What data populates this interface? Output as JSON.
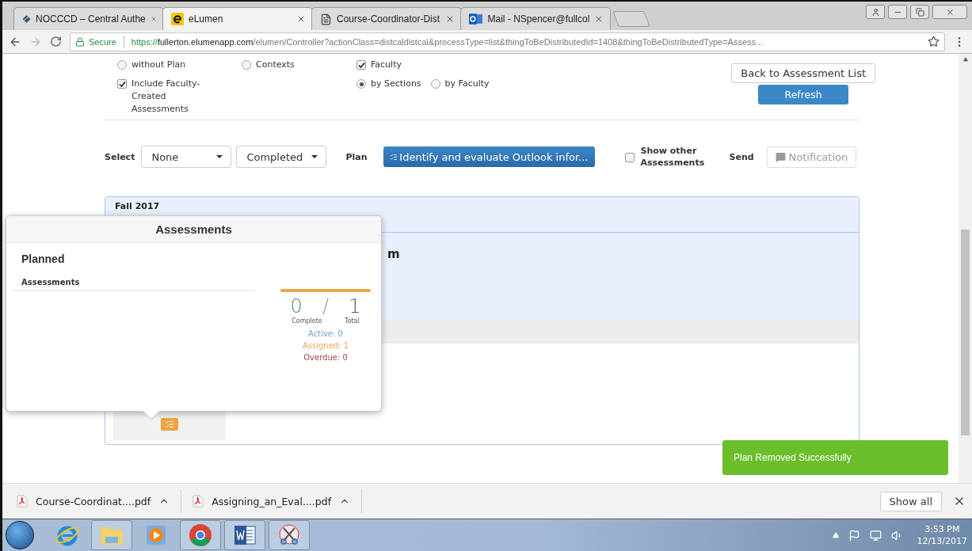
{
  "browser": {
    "tabs": [
      {
        "title": "NOCCCD – Central Authe",
        "selected": false
      },
      {
        "title": "eLumen",
        "selected": true
      },
      {
        "title": "Course-Coordinator-Dist",
        "selected": false
      },
      {
        "title": "Mail - NSpencer@fullcol",
        "selected": false
      }
    ],
    "secure_label": "Secure",
    "url_scheme": "https://",
    "url_host": "fullerton.elumenapp.com",
    "url_path": "/elumen/Controller?actionClass=distcaldistcal&processType=list&thingToBeDistributedId=1408&thingToBeDistributedType=Assess..."
  },
  "options": {
    "columns": [
      {
        "items": [
          {
            "kind": "radio",
            "label": "without Plan",
            "selected": false
          },
          {
            "kind": "checkbox",
            "label": "Include Faculty-Created Assessments",
            "checked": true
          }
        ]
      },
      {
        "items": [
          {
            "kind": "radio",
            "label": "Contexts",
            "selected": false
          }
        ]
      },
      {
        "items": [
          {
            "kind": "checkbox",
            "label": "Faculty",
            "checked": true
          },
          {
            "kind": "radio_row",
            "options": [
              {
                "label": "by Sections",
                "selected": true
              },
              {
                "label": "by Faculty",
                "selected": false
              }
            ]
          }
        ]
      }
    ],
    "back_button": "Back to Assessment List",
    "refresh_button": "Refresh"
  },
  "toolbar": {
    "select_label": "Select",
    "dropdowns": [
      "None",
      "Completed"
    ],
    "plan_label": "Plan",
    "plan_button": "Identify and evaluate Outlook infor...",
    "show_other": {
      "label": "Show other Assessments",
      "checked": false
    },
    "send_label": "Send",
    "notification_button": {
      "label": "Notification",
      "disabled": true
    }
  },
  "panel": {
    "term": "Fall 2017",
    "heading_fragment": "m"
  },
  "popup": {
    "title": "Assessments",
    "section": "Planned",
    "column_header": "Assessments",
    "complete": "0",
    "separator": "/",
    "total": "1",
    "complete_label": "Complete",
    "total_label": "Total",
    "statuses": [
      {
        "label": "Active: 0",
        "color": "#6f9fd8"
      },
      {
        "label": "Assigned: 1",
        "color": "#f2a45a"
      },
      {
        "label": "Overdue: 0",
        "color": "#a84848"
      }
    ]
  },
  "toast": "Plan Removed Successfully",
  "downloads": {
    "files": [
      "Course-Coordinat....pdf",
      "Assigning_an_Eval....pdf"
    ],
    "show_all": "Show all"
  },
  "taskbar": {
    "apps": [
      {
        "kind": "ie"
      },
      {
        "kind": "folder"
      },
      {
        "kind": "media"
      },
      {
        "kind": "chrome"
      },
      {
        "kind": "word"
      },
      {
        "kind": "snip"
      }
    ],
    "time": "3:53 PM",
    "date": "12/13/2017"
  }
}
